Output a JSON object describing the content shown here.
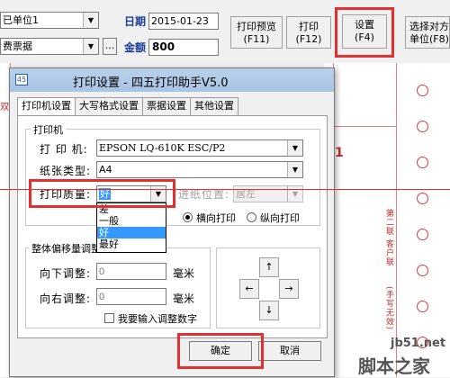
{
  "toolbar": {
    "unit_combo": "已单位1",
    "bill_combo": "费票据",
    "ellipsis": "...",
    "date_label": "日期",
    "date_value": "2015-01-23",
    "amount_label": "金额",
    "amount_value": "800",
    "btn_preview": "打印预览",
    "btn_preview_key": "(F11)",
    "btn_print": "打印",
    "btn_print_key": "(F12)",
    "btn_settings": "设置",
    "btn_settings_key": "(F4)",
    "btn_select_unit_1": "选择对方",
    "btn_select_unit_2": "单位(F8)"
  },
  "dialog": {
    "title": "打印设置 - 四五打印助手V5.0",
    "tabs": [
      "打印机设置",
      "大写格式设置",
      "票据设置",
      "其他设置"
    ],
    "printer_group": "打印机",
    "printer_label": "打 印 机:",
    "printer_value": "EPSON LQ-610K ESC/P2",
    "paper_label": "纸张类型:",
    "paper_value": "A4",
    "quality_label": "打印质量:",
    "quality_value": "好",
    "quality_options": [
      "差",
      "一般",
      "好",
      "最好"
    ],
    "feed_label": "进纸位置:",
    "feed_value": "居左",
    "orient_landscape": "横向打印",
    "orient_portrait": "纵向打印",
    "offset_group": "整体偏移量调整",
    "down_label": "向下调整:",
    "down_placeholder": "0",
    "right_label": "向右调整:",
    "right_placeholder": "0",
    "unit_mm": "毫米",
    "manual_input": "我要输入调整数字",
    "arrow_up": "↑",
    "arrow_down": "↓",
    "arrow_left": "←",
    "arrow_right": "→",
    "ok": "确定",
    "cancel": "取消"
  },
  "document": {
    "side_text_1": "第二联 客户联",
    "side_text_2": "(手写无效)",
    "mark": "1",
    "left_mark": "双"
  },
  "watermark": {
    "site": "jb51.net",
    "name": "脚本之家"
  },
  "colors": {
    "highlight_red": "#e23030",
    "selection_blue": "#3399ff",
    "label_blue": "#1a3c9c"
  }
}
